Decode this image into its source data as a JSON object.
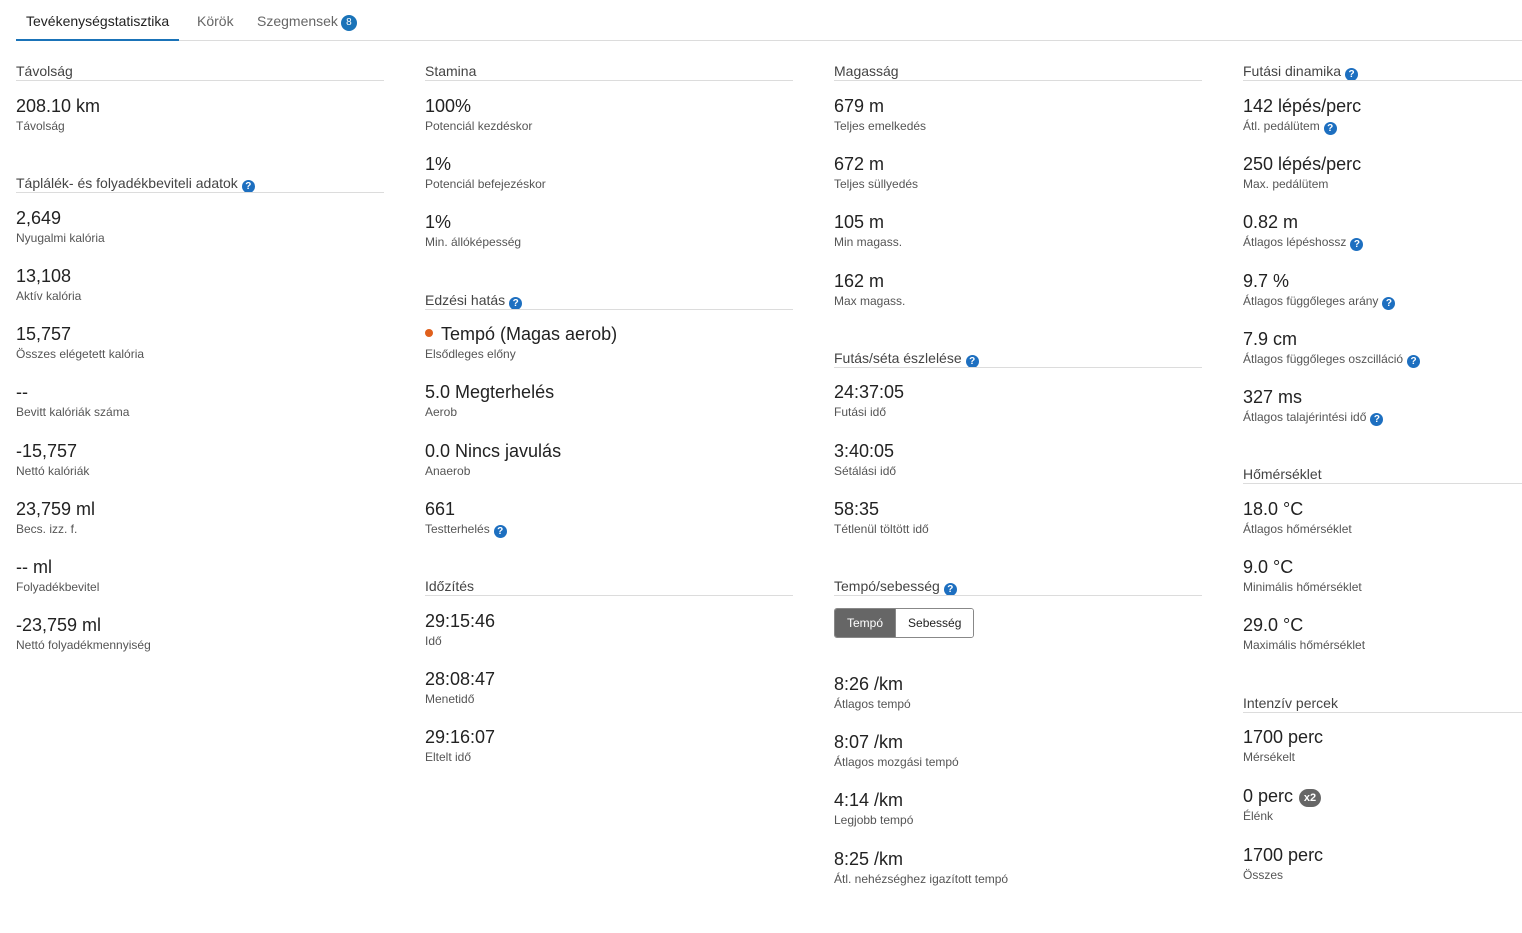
{
  "tabs": [
    {
      "label": "Tevékenységstatisztika",
      "active": true
    },
    {
      "label": "Körök"
    },
    {
      "label": "Szegmensek",
      "badge": "8"
    }
  ],
  "icons": {
    "help": "?"
  },
  "accent_color": "#1a73b8",
  "training_dot_color": "#e0601c",
  "col1": {
    "distance": {
      "title": "Távolság",
      "stats": [
        {
          "value": "208.10 km",
          "label": "Távolság"
        }
      ]
    },
    "nutrition": {
      "title": "Táplálék- és folyadékbeviteli adatok",
      "stats": [
        {
          "value": "2,649",
          "label": "Nyugalmi kalória"
        },
        {
          "value": "13,108",
          "label": "Aktív kalória"
        },
        {
          "value": "15,757",
          "label": "Összes elégetett kalória"
        },
        {
          "value": "--",
          "label": "Bevitt kalóriák száma"
        },
        {
          "value": "-15,757",
          "label": "Nettó kalóriák"
        },
        {
          "value": "23,759 ml",
          "label": "Becs. izz. f."
        },
        {
          "value": "-- ml",
          "label": "Folyadékbevitel"
        },
        {
          "value": "-23,759 ml",
          "label": "Nettó folyadékmennyiség"
        }
      ]
    }
  },
  "col2": {
    "stamina": {
      "title": "Stamina",
      "stats": [
        {
          "value": "100%",
          "label": "Potenciál kezdéskor"
        },
        {
          "value": "1%",
          "label": "Potenciál befejezéskor"
        },
        {
          "value": "1%",
          "label": "Min. állóképesség"
        }
      ]
    },
    "training": {
      "title": "Edzési hatás",
      "stats": [
        {
          "value": "Tempó (Magas aerob)",
          "label": "Elsődleges előny"
        },
        {
          "value": "5.0 Megterhelés",
          "label": "Aerob"
        },
        {
          "value": "0.0 Nincs javulás",
          "label": "Anaerob"
        },
        {
          "value": "661",
          "label": "Testterhelés"
        }
      ]
    },
    "timing": {
      "title": "Időzítés",
      "stats": [
        {
          "value": "29:15:46",
          "label": "Idő"
        },
        {
          "value": "28:08:47",
          "label": "Menetidő"
        },
        {
          "value": "29:16:07",
          "label": "Eltelt idő"
        }
      ]
    }
  },
  "col3": {
    "elevation": {
      "title": "Magasság",
      "stats": [
        {
          "value": "679 m",
          "label": "Teljes emelkedés"
        },
        {
          "value": "672 m",
          "label": "Teljes süllyedés"
        },
        {
          "value": "105 m",
          "label": "Min magass."
        },
        {
          "value": "162 m",
          "label": "Max magass."
        }
      ]
    },
    "runwalk": {
      "title": "Futás/séta észlelése",
      "stats": [
        {
          "value": "24:37:05",
          "label": "Futási idő"
        },
        {
          "value": "3:40:05",
          "label": "Sétálási idő"
        },
        {
          "value": "58:35",
          "label": "Tétlenül töltött idő"
        }
      ]
    },
    "pace": {
      "title": "Tempó/sebesség",
      "toggle": {
        "on": "Tempó",
        "off": "Sebesség"
      },
      "stats": [
        {
          "value": "8:26 /km",
          "label": "Átlagos tempó"
        },
        {
          "value": "8:07 /km",
          "label": "Átlagos mozgási tempó"
        },
        {
          "value": "4:14 /km",
          "label": "Legjobb tempó"
        },
        {
          "value": "8:25 /km",
          "label": "Átl. nehézséghez igazított tempó"
        }
      ]
    }
  },
  "col4": {
    "dynamics": {
      "title": "Futási dinamika",
      "stats": [
        {
          "value": "142 lépés/perc",
          "label": "Átl. pedálütem"
        },
        {
          "value": "250 lépés/perc",
          "label": "Max. pedálütem"
        },
        {
          "value": "0.82 m",
          "label": "Átlagos lépéshossz"
        },
        {
          "value": "9.7 %",
          "label": "Átlagos függőleges arány"
        },
        {
          "value": "7.9 cm",
          "label": "Átlagos függőleges oszcilláció"
        },
        {
          "value": "327 ms",
          "label": "Átlagos talajérintési idő"
        }
      ]
    },
    "temperature": {
      "title": "Hőmérséklet",
      "stats": [
        {
          "value": "18.0 °C",
          "label": "Átlagos hőmérséklet"
        },
        {
          "value": "9.0 °C",
          "label": "Minimális hőmérséklet"
        },
        {
          "value": "29.0 °C",
          "label": "Maximális hőmérséklet"
        }
      ]
    },
    "intensity": {
      "title": "Intenzív percek",
      "badge": "x2",
      "stats": [
        {
          "value": "1700 perc",
          "label": "Mérsékelt"
        },
        {
          "value": "0 perc",
          "label": "Élénk"
        },
        {
          "value": "1700 perc",
          "label": "Összes"
        }
      ]
    }
  }
}
